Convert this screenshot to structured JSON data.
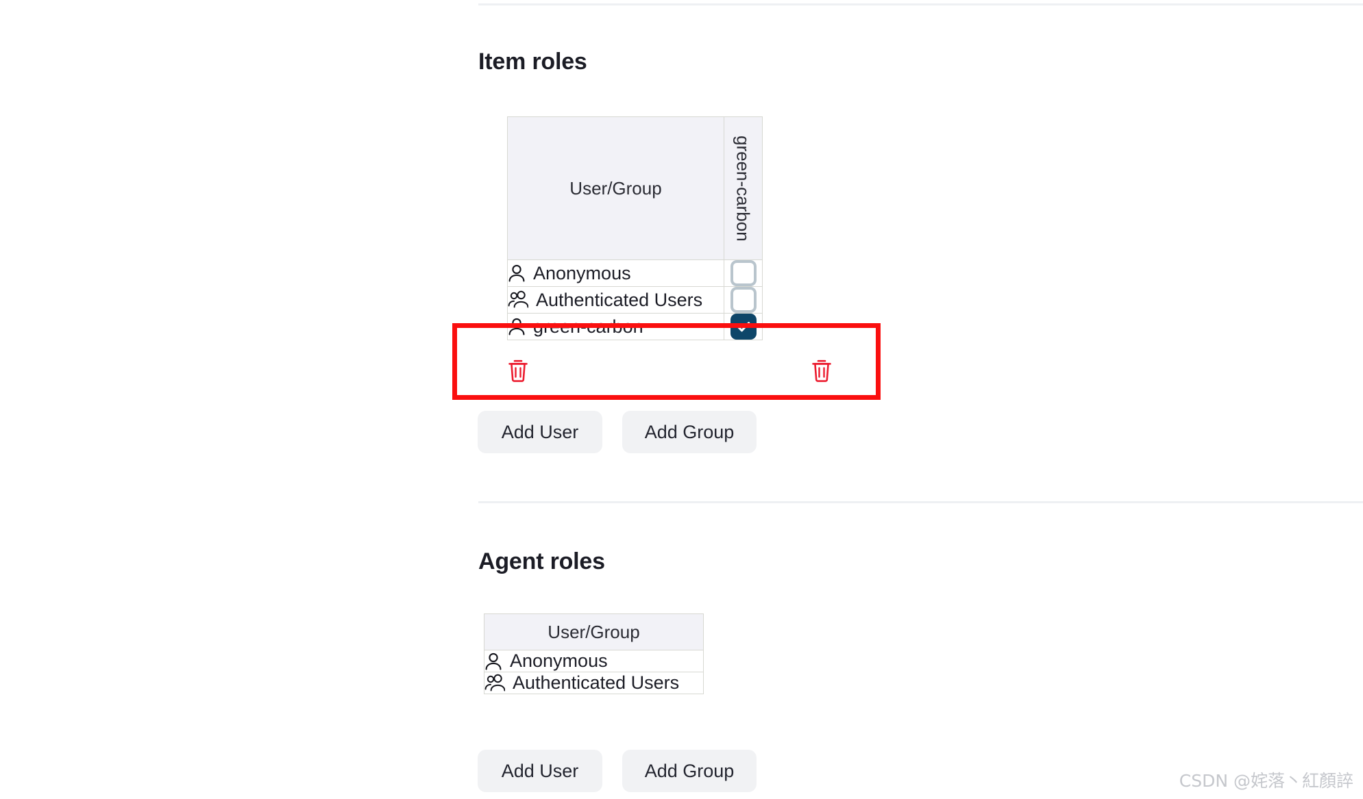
{
  "page": {
    "watermark": "CSDN @姹落丶紅顏誶"
  },
  "item_roles": {
    "heading": "Item roles",
    "table": {
      "columns": [
        {
          "label": "User/Group",
          "orientation": "horizontal"
        },
        {
          "label": "green-carbon",
          "orientation": "vertical"
        }
      ],
      "rows": [
        {
          "principal": "Anonymous",
          "icon": "person-icon",
          "checked": false,
          "deletable": false
        },
        {
          "principal": "Authenticated Users",
          "icon": "group-icon",
          "checked": false,
          "deletable": false
        },
        {
          "principal": "green-carbon",
          "icon": "person-icon",
          "checked": true,
          "deletable": true
        }
      ]
    },
    "buttons": {
      "add_user": "Add User",
      "add_group": "Add Group"
    }
  },
  "agent_roles": {
    "heading": "Agent roles",
    "table": {
      "columns": [
        {
          "label": "User/Group",
          "orientation": "horizontal"
        }
      ],
      "rows": [
        {
          "principal": "Anonymous",
          "icon": "person-icon"
        },
        {
          "principal": "Authenticated Users",
          "icon": "group-icon"
        }
      ]
    },
    "buttons": {
      "add_user": "Add User",
      "add_group": "Add Group"
    }
  },
  "annotation": {
    "color": "#fa0f0f",
    "target_row": "green-carbon"
  },
  "colors": {
    "heading": "#1b1c25",
    "header_row_bg": "#f2f2f7",
    "table_border": "#d7d8d2",
    "checkbox_checked_bg": "#0e4669",
    "checkbox_unchecked_border": "#b9c5cd",
    "trash_icon": "#ec1b2e",
    "button_bg": "#f1f2f4",
    "divider": "#eef0f3"
  }
}
